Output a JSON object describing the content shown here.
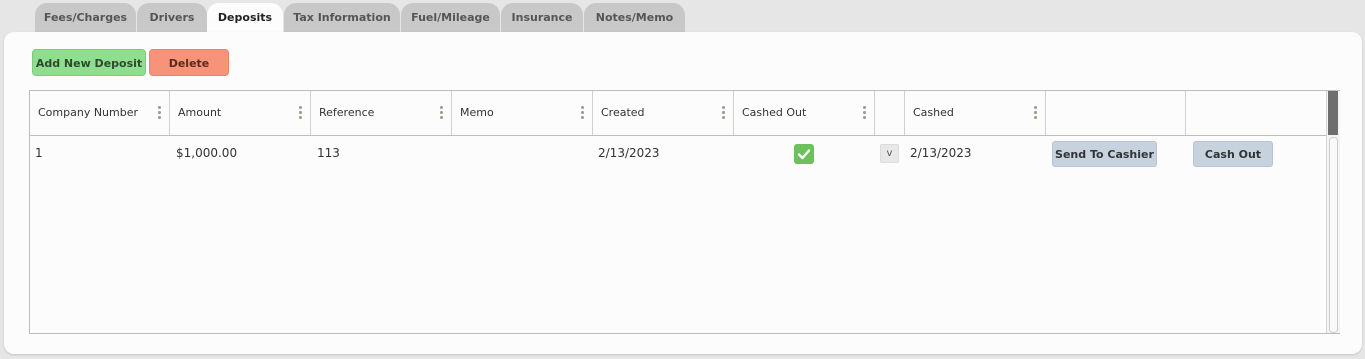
{
  "tabs": [
    {
      "label": "Fees/Charges",
      "active": false
    },
    {
      "label": "Drivers",
      "active": false
    },
    {
      "label": "Deposits",
      "active": true
    },
    {
      "label": "Tax Information",
      "active": false
    },
    {
      "label": "Fuel/Mileage",
      "active": false
    },
    {
      "label": "Insurance",
      "active": false
    },
    {
      "label": "Notes/Memo",
      "active": false
    }
  ],
  "toolbar": {
    "add_label": "Add New Deposit",
    "delete_label": "Delete"
  },
  "grid": {
    "columns": [
      "Company Number",
      "Amount",
      "Reference",
      "Memo",
      "Created",
      "Cashed Out",
      "",
      "Cashed",
      "",
      ""
    ],
    "rows": [
      {
        "company_number": "1",
        "amount": "$1,000.00",
        "reference": "113",
        "memo": "",
        "created": "2/13/2023",
        "cashed_out": true,
        "v_label": "v",
        "cashed": "2/13/2023",
        "send_label": "Send To Cashier",
        "cash_out_label": "Cash Out"
      }
    ]
  },
  "colors": {
    "add_button": "#8fde90",
    "delete_button": "#f79378",
    "check": "#6cc15a",
    "row_button": "#c6d2dd"
  },
  "icons": {
    "check": "check-icon",
    "column_menu": "kebab-menu-icon"
  }
}
